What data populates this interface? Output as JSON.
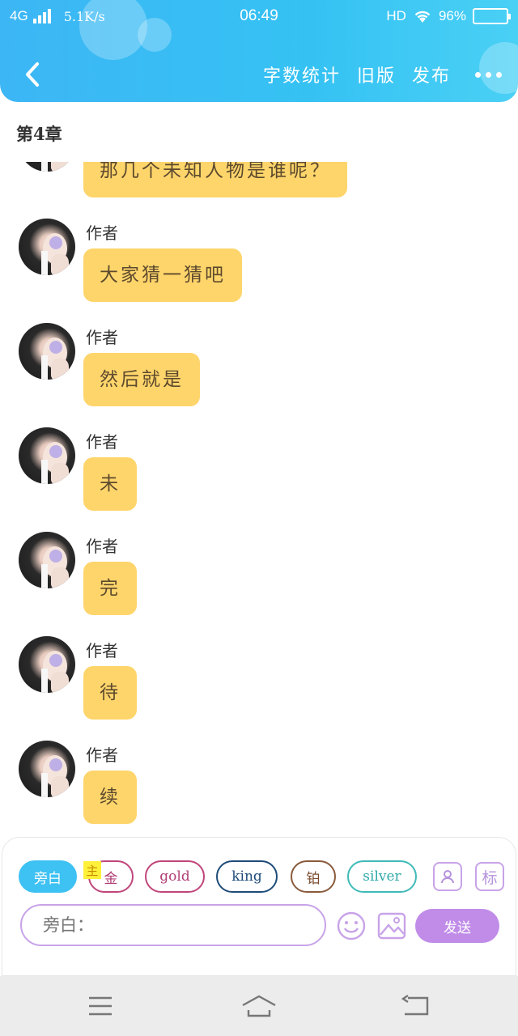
{
  "status_bar": {
    "network": "4G",
    "speed": "5.1K/s",
    "time": "06:49",
    "hd": "HD",
    "battery": "96%",
    "battery_level": 0.96
  },
  "header": {
    "actions": [
      "字数统计",
      "旧版",
      "发布"
    ],
    "background_color": "#3db6f5"
  },
  "chapter_title": "第4章",
  "messages": [
    {
      "sender": "",
      "text": "那几个未知人物是谁呢？",
      "partial": true
    },
    {
      "sender": "作者",
      "text": "大家猜一猜吧"
    },
    {
      "sender": "作者",
      "text": "然后就是"
    },
    {
      "sender": "作者",
      "text": "未"
    },
    {
      "sender": "作者",
      "text": "完"
    },
    {
      "sender": "作者",
      "text": "待"
    },
    {
      "sender": "作者",
      "text": "续"
    }
  ],
  "bubble_color": "#fed56b",
  "role_chips": [
    {
      "label": "旁白",
      "active": true
    },
    {
      "label": "金",
      "active": false
    },
    {
      "label": "gold",
      "active": false
    },
    {
      "label": "king",
      "active": false
    },
    {
      "label": "铂",
      "active": false
    },
    {
      "label": "silver",
      "active": false
    }
  ],
  "main_tag": "主",
  "side_icons": {
    "profile": "person-card-icon",
    "tag_label": "标"
  },
  "input": {
    "placeholder": "旁白："
  },
  "send_label": "发送",
  "accent_color": "#c08ce8"
}
